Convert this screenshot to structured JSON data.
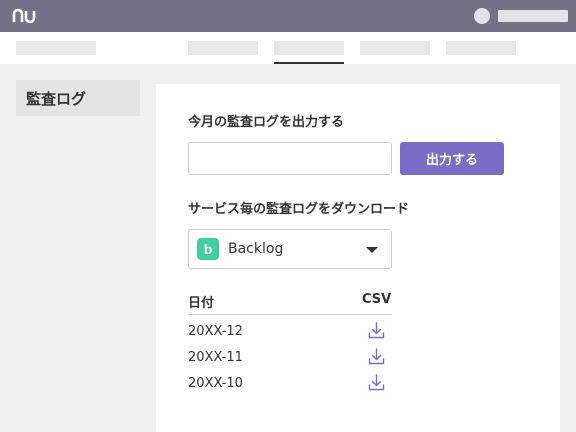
{
  "sidebar": {
    "items": [
      {
        "label": "監査ログ"
      }
    ]
  },
  "main": {
    "monthly": {
      "title": "今月の監査ログを出力する",
      "input_value": "",
      "button_label": "出力する"
    },
    "service": {
      "title": "サービス毎の監査ログをダウンロード",
      "selected": "Backlog",
      "logo_letter": "b"
    },
    "table": {
      "headers": [
        "日付",
        "CSV"
      ],
      "rows": [
        {
          "date": "20XX-12"
        },
        {
          "date": "20XX-11"
        },
        {
          "date": "20XX-10"
        }
      ]
    }
  },
  "colors": {
    "topbar": "#727386",
    "accent": "#7a6cc4",
    "backlog": "#42ce9f"
  },
  "icons": {
    "logo": "nulab-logo",
    "download": "download-icon",
    "caret": "chevron-down-icon"
  }
}
